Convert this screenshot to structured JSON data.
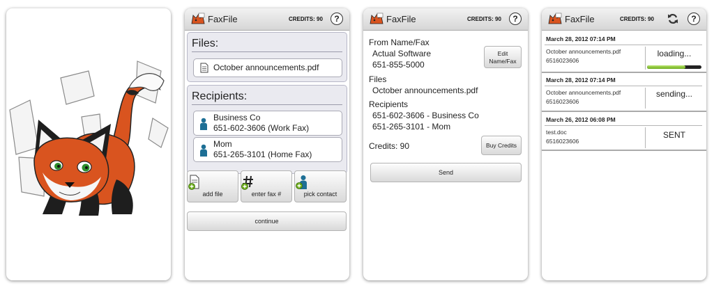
{
  "app": {
    "title": "FaxFile",
    "credits_label": "CREDITS: 90",
    "help_label": "?"
  },
  "compose": {
    "files_heading": "Files:",
    "files": [
      {
        "name": "October announcements.pdf"
      }
    ],
    "recipients_heading": "Recipients:",
    "recipients": [
      {
        "name": "Business Co",
        "detail": "651-602-3606 (Work Fax)"
      },
      {
        "name": "Mom",
        "detail": "651-265-3101 (Home Fax)"
      }
    ],
    "actions": [
      {
        "label": "add file",
        "icon": "add-file-icon"
      },
      {
        "label": "enter fax #",
        "icon": "hash-add-icon"
      },
      {
        "label": "pick contact",
        "icon": "contact-add-icon"
      }
    ],
    "continue_label": "continue"
  },
  "review": {
    "from_label": "From Name/Fax",
    "from_name": "Actual Software",
    "from_fax": "651-855-5000",
    "edit_label_1": "Edit",
    "edit_label_2": "Name/Fax",
    "files_label": "Files",
    "file_name": "October announcements.pdf",
    "recipients_label": "Recipients",
    "recipients": [
      "651-602-3606 - Business Co",
      "651-265-3101 - Mom"
    ],
    "credits_text": "Credits: 90",
    "buy_label": "Buy Credits",
    "send_label": "Send"
  },
  "history": {
    "entries": [
      {
        "date": "March 28, 2012 07:14 PM",
        "file": "October announcements.pdf",
        "number": "6516023606",
        "status": "loading...",
        "progress": 0.7
      },
      {
        "date": "March 28, 2012 07:14 PM",
        "file": "October announcements.pdf",
        "number": "6516023606",
        "status": "sending..."
      },
      {
        "date": "March 26, 2012 06:08 PM",
        "file": "test.doc",
        "number": "6516023606",
        "status": "SENT"
      }
    ]
  },
  "colors": {
    "accent_green": "#6dac1c",
    "fox_orange": "#d9541f",
    "person_blue": "#1d6f95"
  }
}
